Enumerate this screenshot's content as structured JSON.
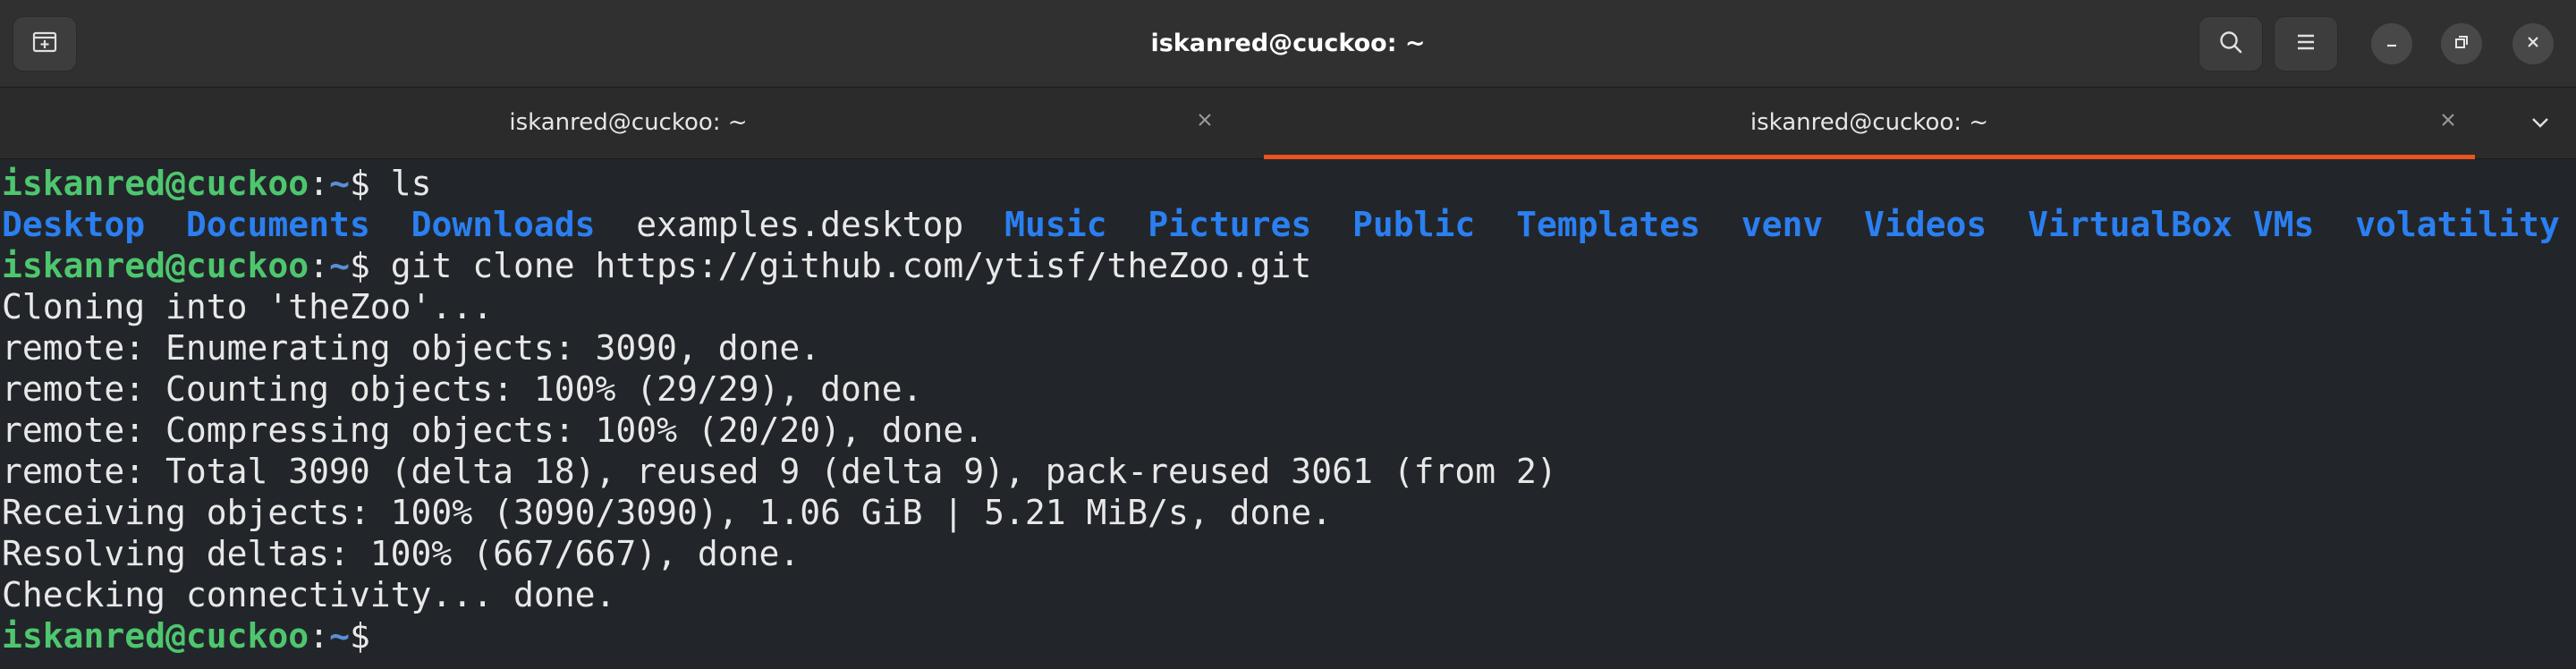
{
  "window": {
    "title": "iskanred@cuckoo: ~",
    "new_tab_icon": "new-tab-icon",
    "search_icon": "search-icon",
    "menu_icon": "hamburger-menu-icon",
    "minimize_icon": "minimize-icon",
    "restore_icon": "restore-icon",
    "close_icon": "close-icon"
  },
  "tabs": [
    {
      "label": "iskanred@cuckoo: ~",
      "active": false
    },
    {
      "label": "iskanred@cuckoo: ~",
      "active": true
    }
  ],
  "colors": {
    "accent": "#e95420",
    "prompt_user": "#4ec66e",
    "prompt_path": "#5b8fd6",
    "directory": "#2b7ff0",
    "text": "#e8e8e8",
    "background": "#22262a"
  },
  "terminal": {
    "prompt_user_host": "iskanred@cuckoo",
    "prompt_sep": ":",
    "prompt_path": "~",
    "prompt_symbol": "$",
    "cmd1": " ls",
    "ls_entries": [
      {
        "name": "Desktop",
        "type": "dir"
      },
      {
        "name": "Documents",
        "type": "dir"
      },
      {
        "name": "Downloads",
        "type": "dir"
      },
      {
        "name": "examples.desktop",
        "type": "file"
      },
      {
        "name": "Music",
        "type": "dir"
      },
      {
        "name": "Pictures",
        "type": "dir"
      },
      {
        "name": "Public",
        "type": "dir"
      },
      {
        "name": "Templates",
        "type": "dir"
      },
      {
        "name": "venv",
        "type": "dir"
      },
      {
        "name": "Videos",
        "type": "dir"
      },
      {
        "name": "VirtualBox VMs",
        "type": "dir"
      },
      {
        "name": "volatility",
        "type": "dir"
      }
    ],
    "cmd2": " git clone https://github.com/ytisf/theZoo.git",
    "output": [
      "Cloning into 'theZoo'...",
      "remote: Enumerating objects: 3090, done.",
      "remote: Counting objects: 100% (29/29), done.",
      "remote: Compressing objects: 100% (20/20), done.",
      "remote: Total 3090 (delta 18), reused 9 (delta 9), pack-reused 3061 (from 2)",
      "Receiving objects: 100% (3090/3090), 1.06 GiB | 5.21 MiB/s, done.",
      "Resolving deltas: 100% (667/667), done.",
      "Checking connectivity... done."
    ]
  }
}
